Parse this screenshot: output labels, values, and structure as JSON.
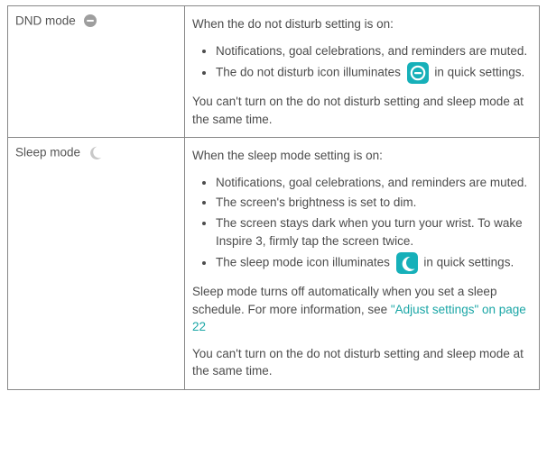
{
  "rows": [
    {
      "label": "DND mode",
      "intro": "When the do not disturb setting is on:",
      "bullets": [
        "Notifications, goal celebrations, and reminders are muted.",
        {
          "pre": "The do not disturb icon illuminates",
          "post": "in quick settings."
        }
      ],
      "after": [
        "You can't turn on the do not disturb setting and sleep mode at the same time."
      ]
    },
    {
      "label": "Sleep mode",
      "intro": "When the sleep mode setting is on:",
      "bullets": [
        "Notifications, goal celebrations, and reminders are muted.",
        "The screen's brightness is set to dim.",
        "The screen stays dark when you turn your wrist. To wake Inspire 3, firmly tap the screen twice.",
        {
          "pre": "The sleep mode icon illuminates",
          "post": "in quick settings."
        }
      ],
      "after": [
        {
          "pre": "Sleep mode turns off automatically when you set a sleep schedule. For more information, see ",
          "link": "\"Adjust settings\" on page 22"
        },
        "You can't turn on the do not disturb setting and sleep mode at the same time."
      ]
    }
  ]
}
